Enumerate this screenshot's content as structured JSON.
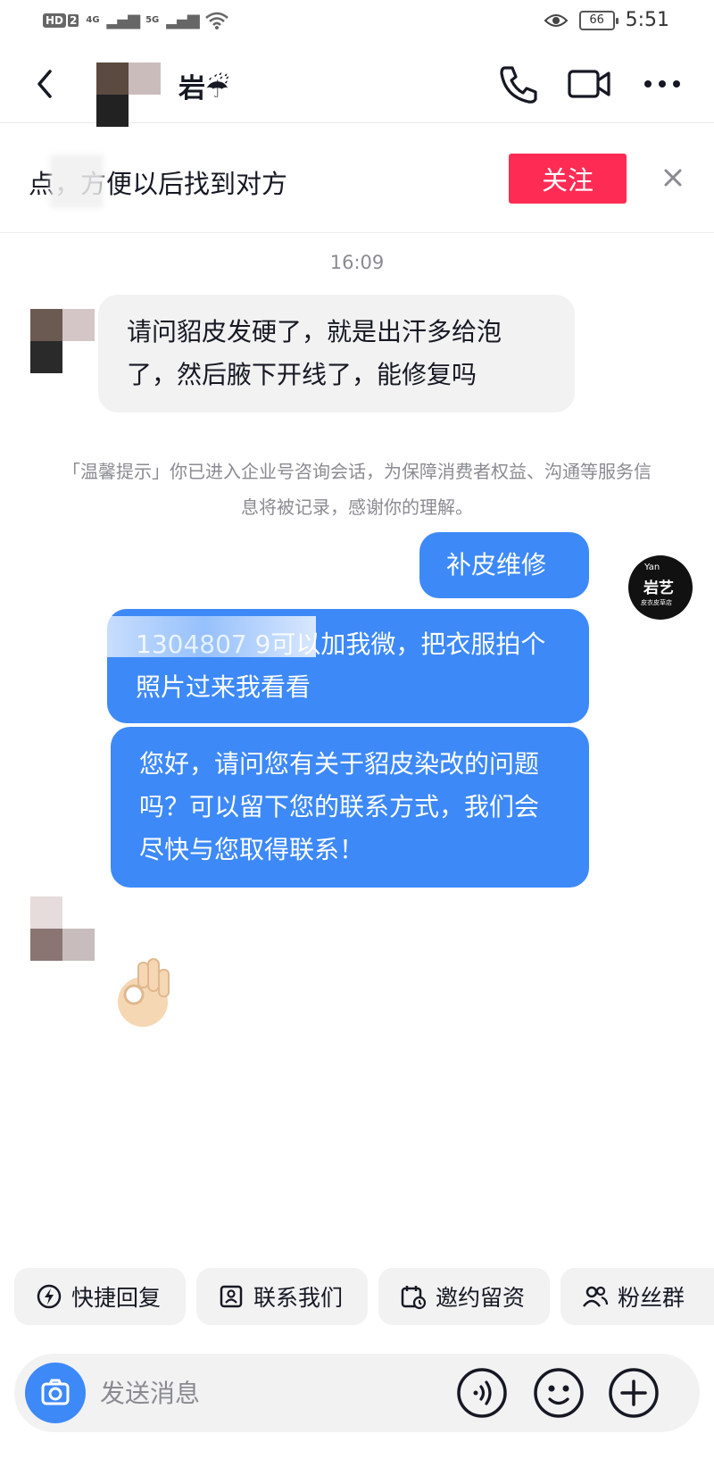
{
  "status_bar": {
    "network_hd": "HD",
    "network_2": "2",
    "network_4g": "4G",
    "network_5g": "5G",
    "battery": "66",
    "time": "5:51"
  },
  "header": {
    "contact_name": "岩☔",
    "icons": [
      "back-arrow-icon",
      "phone-icon",
      "video-camera-icon",
      "more-icon"
    ]
  },
  "follow_bar": {
    "text": "点，方便以后找到对方",
    "button_label": "关注"
  },
  "chat": {
    "timestamp": "16:09",
    "messages": [
      {
        "from": "contact",
        "text": "请问貂皮发硬了，就是出汗多给泡了，然后腋下开线了，能修复吗"
      },
      {
        "from": "system",
        "text": "「温馨提示」你已进入企业号咨询会话，为保障消费者权益、沟通等服务信息将被记录，感谢你的理解。"
      },
      {
        "from": "me",
        "text": "补皮维修"
      },
      {
        "from": "me",
        "text": "1304807 9可以加我微，把衣服拍个照片过来我看看"
      },
      {
        "from": "me",
        "text": "您好，请问您有关于貂皮染改的问题吗？可以留下您的联系方式，我们会尽快与您取得联系！"
      },
      {
        "from": "contact",
        "text": "👌"
      }
    ],
    "shop_avatar": {
      "top": "Yan",
      "main": "岩艺",
      "sub": "皮衣皮草店"
    }
  },
  "quick_replies": [
    {
      "label": "快捷回复",
      "icon": "lightning-icon"
    },
    {
      "label": "联系我们",
      "icon": "contact-card-icon"
    },
    {
      "label": "邀约留资",
      "icon": "calendar-icon"
    },
    {
      "label": "粉丝群",
      "icon": "group-icon"
    }
  ],
  "input_bar": {
    "placeholder": "发送消息",
    "icons": [
      "camera-icon",
      "voice-icon",
      "emoji-icon",
      "plus-icon"
    ]
  },
  "colors": {
    "accent_blue": "#3d89f8",
    "follow_red": "#fe2c55",
    "incoming_bubble": "#f2f2f3"
  }
}
